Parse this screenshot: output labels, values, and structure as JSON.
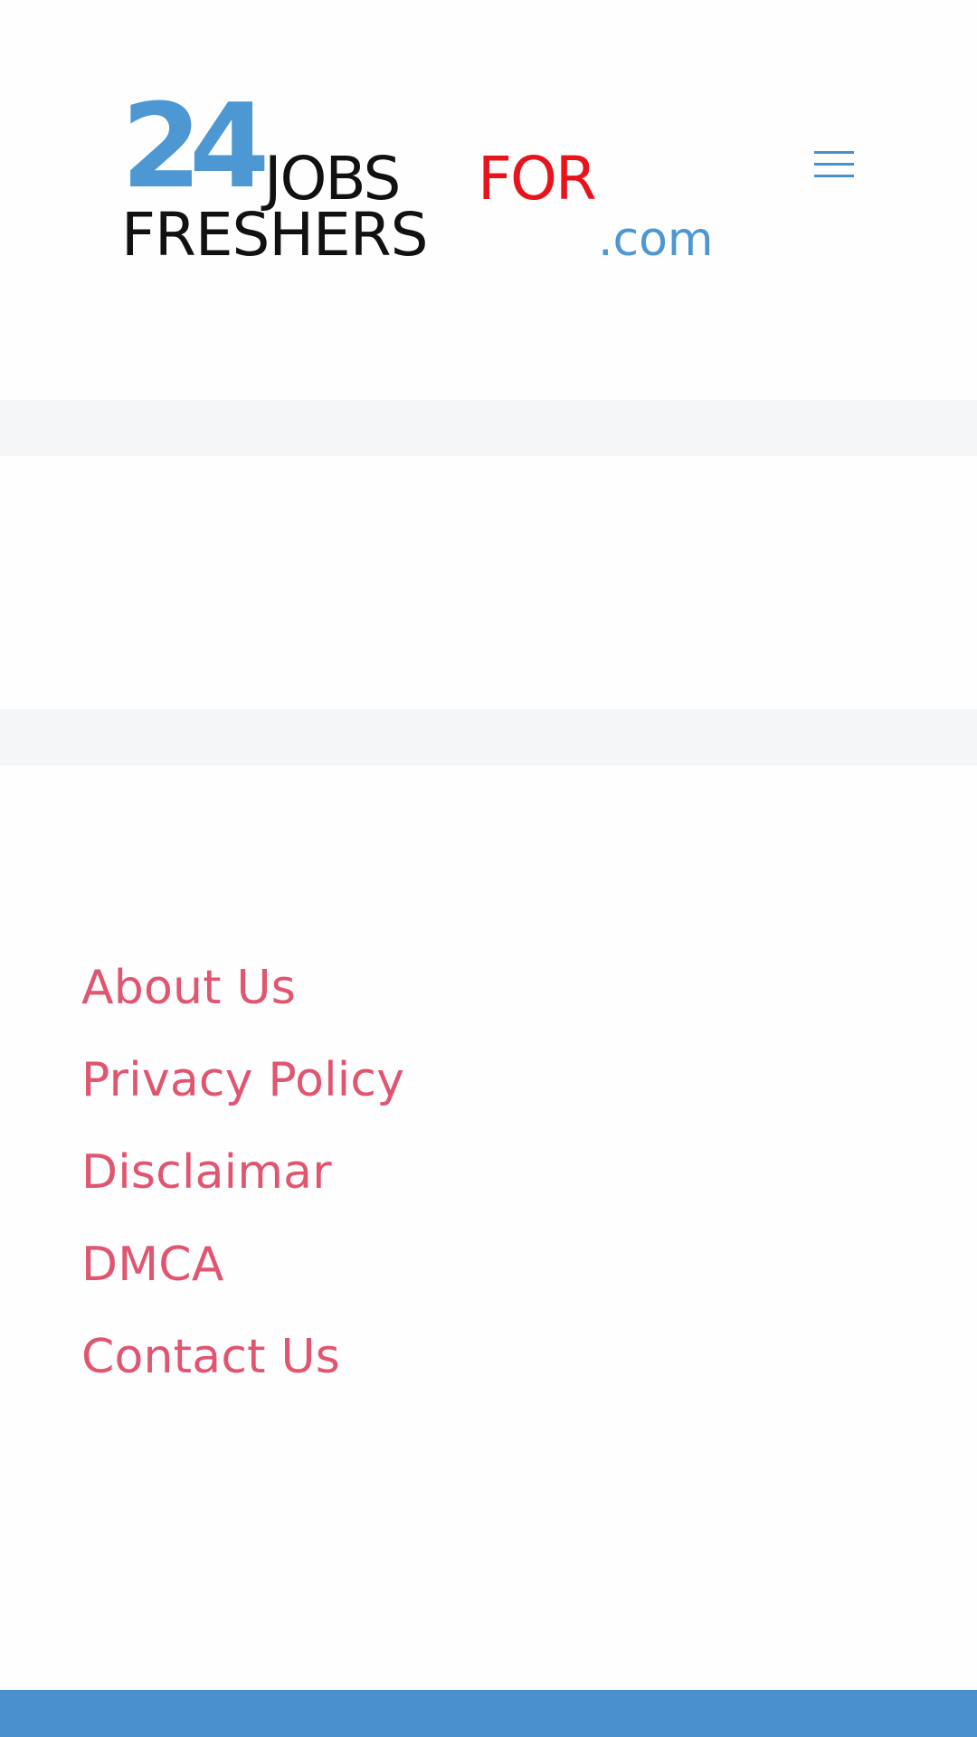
{
  "header": {
    "logo": {
      "number": "24",
      "word_jobs": "JOBS",
      "word_for": "FOR",
      "word_freshers": "FRESHERS",
      "domain": ".com",
      "colors": {
        "blue": "#4d97d3",
        "red": "#e8141c",
        "black": "#111111"
      }
    },
    "menu_icon": "hamburger-menu-icon",
    "menu_icon_color": "#4a90cf"
  },
  "footer": {
    "links": [
      "About Us",
      "Privacy Policy",
      "Disclaimar",
      "DMCA",
      "Contact Us"
    ],
    "link_color": "#e05570"
  },
  "colors": {
    "band": "#f5f6f8",
    "bottom_bar": "#4a90cf",
    "background": "#fefefe"
  }
}
